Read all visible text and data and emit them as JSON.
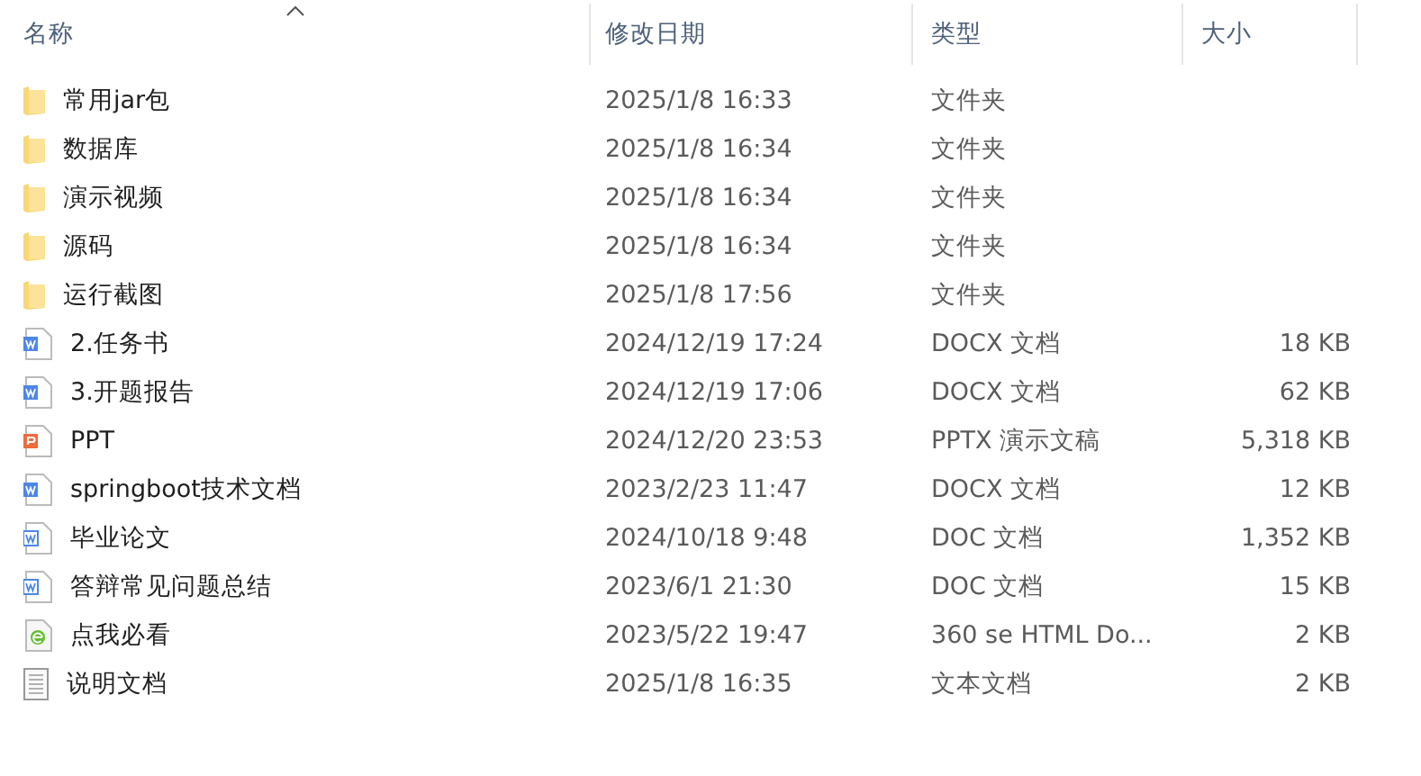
{
  "columns": [
    "名称",
    "修改日期",
    "类型",
    "大小"
  ],
  "rows": [
    {
      "kind": "folder",
      "name": "常用jar包",
      "date": "2025/1/8 16:33",
      "type": "文件夹"
    },
    {
      "kind": "folder",
      "name": "数据库",
      "date": "2025/1/8 16:34",
      "type": "文件夹"
    },
    {
      "kind": "folder",
      "name": "演示视频",
      "date": "2025/1/8 16:34",
      "type": "文件夹"
    },
    {
      "kind": "folder",
      "name": "源码",
      "date": "2025/1/8 16:34",
      "type": "文件夹"
    },
    {
      "kind": "folder",
      "name": "运行截图",
      "date": "2025/1/8 17:56",
      "type": "文件夹"
    },
    {
      "kind": "docx",
      "name": "2.任务书",
      "date": "2024/12/19 17:24",
      "type": "DOCX 文档",
      "size": "18 KB"
    },
    {
      "kind": "docx",
      "name": "3.开题报告",
      "date": "2024/12/19 17:06",
      "type": "DOCX 文档",
      "size": "62 KB"
    },
    {
      "kind": "pptx",
      "name": "PPT",
      "date": "2024/12/20 23:53",
      "type": "PPTX 演示文稿",
      "size": "5,318 KB"
    },
    {
      "kind": "docx",
      "name": "springboot技术文档",
      "date": "2023/2/23 11:47",
      "type": "DOCX 文档",
      "size": "12 KB"
    },
    {
      "kind": "doc",
      "name": "毕业论文",
      "date": "2024/10/18 9:48",
      "type": "DOC 文档",
      "size": "1,352 KB"
    },
    {
      "kind": "doc",
      "name": "答辩常见问题总结",
      "date": "2023/6/1 21:30",
      "type": "DOC 文档",
      "size": "15 KB"
    },
    {
      "kind": "html",
      "name": "点我必看",
      "date": "2023/5/22 19:47",
      "type": "360 se HTML Do...",
      "size": "2 KB"
    },
    {
      "kind": "txt",
      "name": "说明文档",
      "date": "2025/1/8 16:35",
      "type": "文本文档",
      "size": "2 KB"
    }
  ]
}
